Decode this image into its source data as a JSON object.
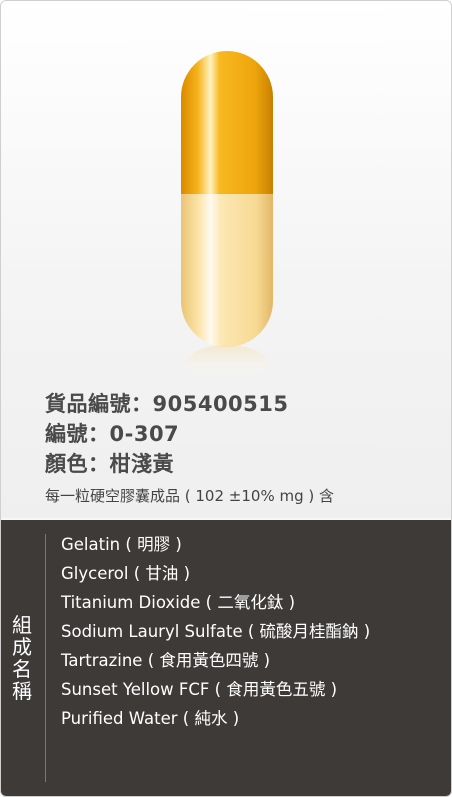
{
  "product": {
    "item_no_label": "貨品編號：",
    "item_no": "905400515",
    "code_label": "編號：",
    "code": "0-307",
    "color_label": "顏色：",
    "color": "柑淺黃",
    "description": "每一粒硬空膠囊成品 ( 102 ±10% mg ) 含"
  },
  "capsule": {
    "cap_color": "#f2b015",
    "body_color": "#fbe3a8"
  },
  "composition": {
    "title_chars": [
      "組",
      "成",
      "名",
      "稱"
    ],
    "items": [
      "Gelatin ( 明膠 )",
      "Glycerol ( 甘油 )",
      "Titanium Dioxide ( 二氧化鈦 )",
      "Sodium Lauryl Sulfate ( 硫酸月桂酯鈉 )",
      "Tartrazine ( 食用黃色四號 )",
      "Sunset Yellow FCF ( 食用黃色五號 )",
      "Purified Water ( 純水 )"
    ]
  }
}
